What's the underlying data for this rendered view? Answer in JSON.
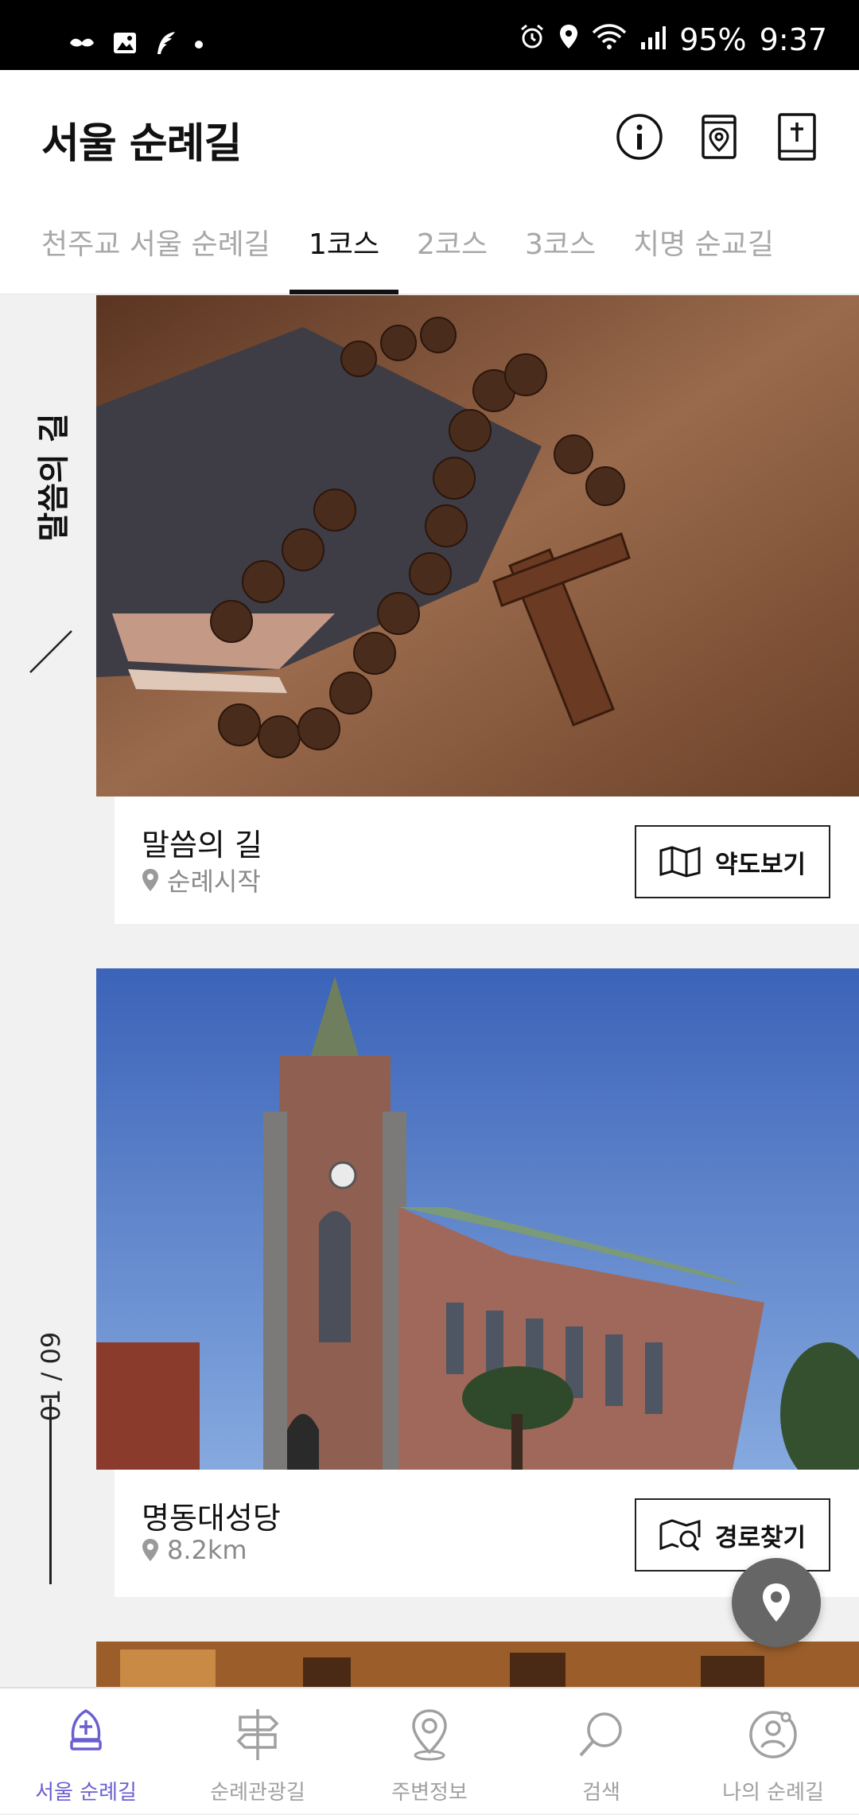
{
  "status_bar": {
    "battery": "95%",
    "time": "9:37"
  },
  "header": {
    "title": "서울 순례길"
  },
  "tabs": [
    {
      "label": "천주교 서울 순례길"
    },
    {
      "label": "1코스"
    },
    {
      "label": "2코스"
    },
    {
      "label": "3코스"
    },
    {
      "label": "치명 순교길"
    }
  ],
  "active_tab": "1코스",
  "rail": {
    "title": "말씀의 길",
    "page": "01 / 09"
  },
  "cards": [
    {
      "name": "말씀의 길",
      "sub": "순례시작",
      "button": "약도보기",
      "button_icon": "map-icon"
    },
    {
      "name": "명동대성당",
      "sub": "8.2km",
      "button": "경로찾기",
      "button_icon": "route-search-icon"
    }
  ],
  "bottom_nav": [
    {
      "label": "서울 순례길",
      "icon": "bishop-mitre-icon",
      "active": true
    },
    {
      "label": "순례관광길",
      "icon": "signpost-icon",
      "active": false
    },
    {
      "label": "주변정보",
      "icon": "location-pin-icon",
      "active": false
    },
    {
      "label": "검색",
      "icon": "search-icon",
      "active": false
    },
    {
      "label": "나의 순례길",
      "icon": "profile-icon",
      "active": false
    }
  ],
  "colors": {
    "accent": "#6a5fd0",
    "inactive": "#a0a0a0",
    "text": "#111111"
  }
}
